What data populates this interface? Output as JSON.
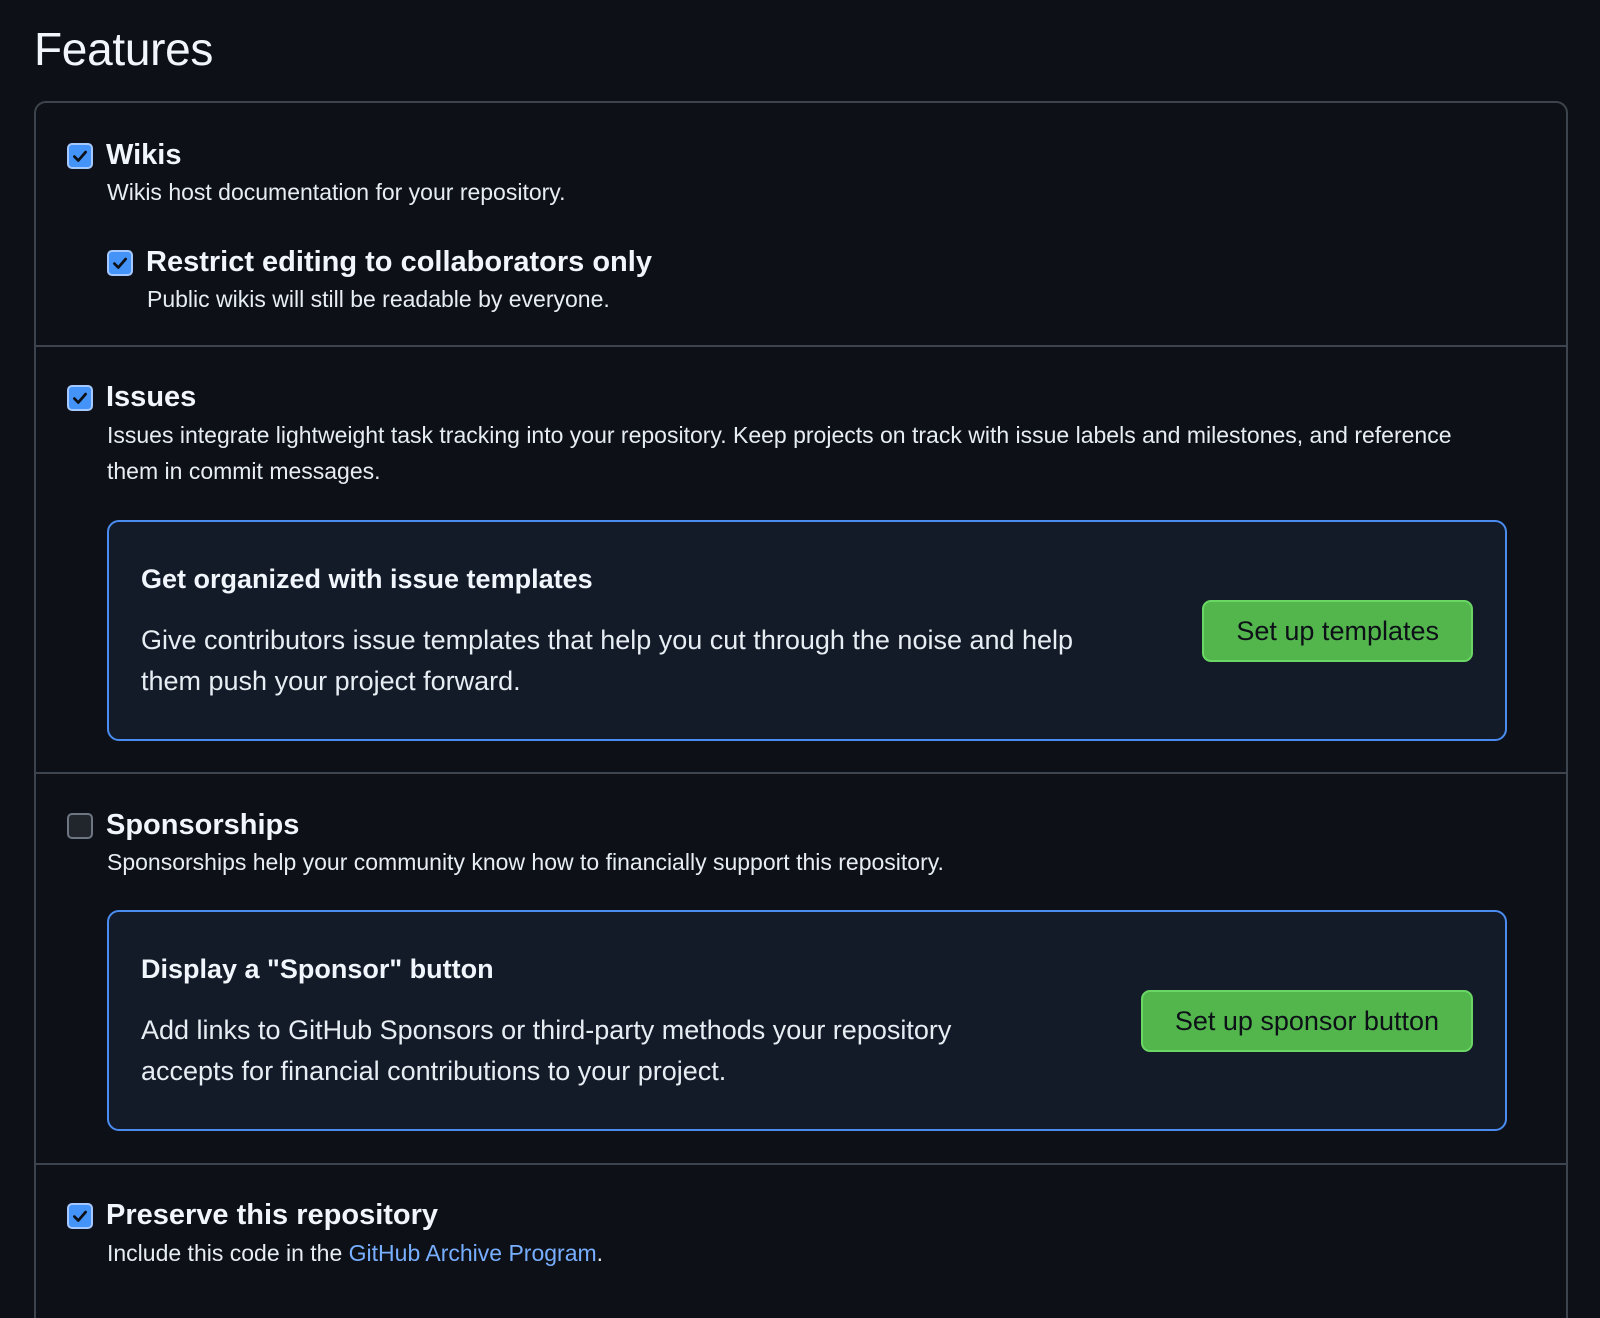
{
  "page": {
    "title": "Features"
  },
  "wikis": {
    "label": "Wikis",
    "checked": true,
    "description": "Wikis host documentation for your repository.",
    "restrict": {
      "label": "Restrict editing to collaborators only",
      "checked": true,
      "description": "Public wikis will still be readable by everyone."
    }
  },
  "issues": {
    "label": "Issues",
    "checked": true,
    "description": "Issues integrate lightweight task tracking into your repository. Keep projects on track with issue labels and milestones, and reference them in commit messages.",
    "callout": {
      "title": "Get organized with issue templates",
      "text": "Give contributors issue templates that help you cut through the noise and help them push your project forward.",
      "button_label": "Set up templates"
    }
  },
  "sponsorships": {
    "label": "Sponsorships",
    "checked": false,
    "description": "Sponsorships help your community know how to financially support this repository.",
    "callout": {
      "title": "Display a \"Sponsor\" button",
      "text": "Add links to GitHub Sponsors or third-party methods your repository accepts for financial contributions to your project.",
      "button_label": "Set up sponsor button"
    }
  },
  "preserve": {
    "label": "Preserve this repository",
    "checked": true,
    "description_prefix": "Include this code in the ",
    "link_text": "GitHub Archive Program",
    "description_suffix": "."
  },
  "colors": {
    "background": "#0d1117",
    "border": "#3d444d",
    "checkbox_checked": "#4493f8",
    "callout_border": "#4a8cf0",
    "callout_background": "#141b28",
    "button_green": "#52b64d",
    "link": "#78aeff"
  },
  "icons": {
    "checkbox_checked": "check-icon"
  }
}
